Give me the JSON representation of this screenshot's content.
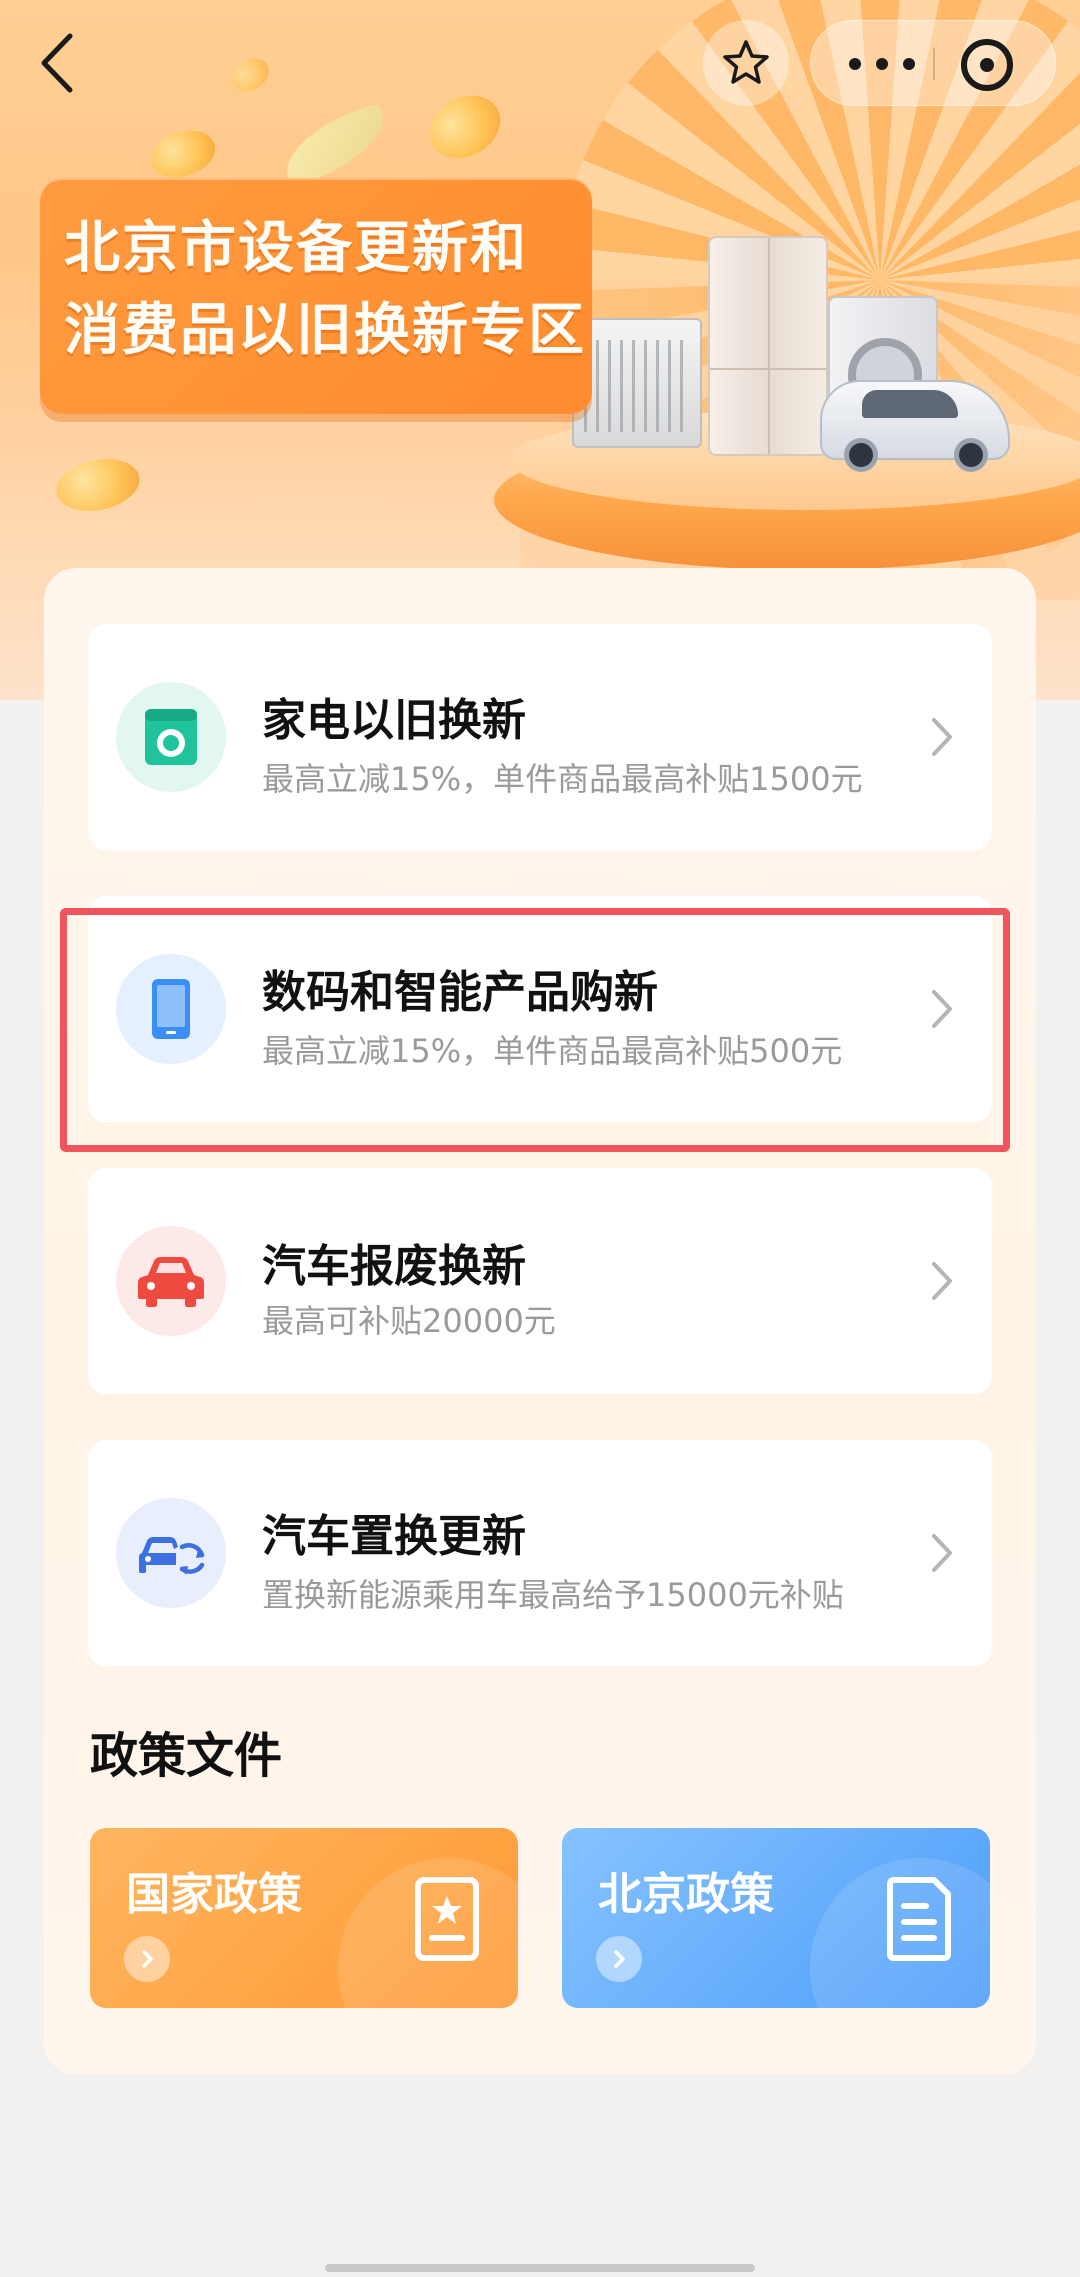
{
  "header": {
    "back_icon": "chevron-left-icon",
    "favorite_icon": "star-outline-icon",
    "more_icon": "more-dots-icon",
    "close_icon": "target-close-icon"
  },
  "banner": {
    "title_line1": "北京市设备更新和",
    "title_line2": "消费品以旧换新专区"
  },
  "programs": [
    {
      "title": "家电以旧换新",
      "subtitle": "最高立减15%，单件商品最高补贴1500元",
      "icon": "washing-machine-icon",
      "icon_color": "#1fc49c",
      "icon_bg": "#e3f7f1"
    },
    {
      "title": "数码和智能产品购新",
      "subtitle": "最高立减15%，单件商品最高补贴500元",
      "icon": "smartphone-icon",
      "icon_color": "#3a8ef6",
      "icon_bg": "#e4f0fd"
    },
    {
      "title": "汽车报废换新",
      "subtitle": "最高可补贴20000元",
      "icon": "car-icon",
      "icon_color": "#ef4a3f",
      "icon_bg": "#fde9e7"
    },
    {
      "title": "汽车置换更新",
      "subtitle": "置换新能源乘用车最高给予15000元补贴",
      "icon": "car-swap-icon",
      "icon_color": "#3d6fe0",
      "icon_bg": "#e8eefc"
    }
  ],
  "policy_section": {
    "title": "政策文件",
    "national_label": "国家政策",
    "beijing_label": "北京政策"
  },
  "colors": {
    "highlight_border": "#f0545d",
    "national_policy": "#ff9a35",
    "beijing_policy": "#4d9dfa"
  }
}
